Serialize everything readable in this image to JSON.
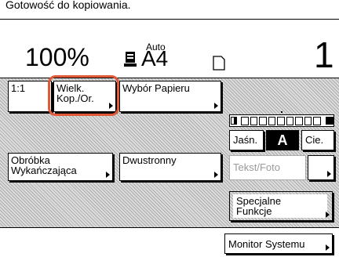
{
  "status": {
    "message": "Gotowość do kopiowania."
  },
  "copy_info": {
    "ratio": "100%",
    "paper_mode": "Auto",
    "paper_size": "A4",
    "paper_tray_icon": "paper-tray-icon",
    "orientation_icon": "document-orientation-icon",
    "count": "1"
  },
  "buttons": {
    "one_to_one": "1:1",
    "enlarge_line1": "Wielk.",
    "enlarge_line2": "Kop./Or.",
    "paper_select": "Wybór Papieru",
    "finishing_line1": "Obróbka",
    "finishing_line2": "Wykańczająca",
    "two_sided": "Dwustronny",
    "special_line1": "Specjalne",
    "special_line2": "Funkcje",
    "system_monitor": "Monitor Systemu"
  },
  "density": {
    "lighter_label": "Jaśn.",
    "auto_label": "A",
    "darker_label": "Cie.",
    "text_photo_label": "Tekst/Foto",
    "levels": 9
  },
  "colors": {
    "highlight_ring": "#e05a3a",
    "hatch_base": "#dcdcdc"
  }
}
